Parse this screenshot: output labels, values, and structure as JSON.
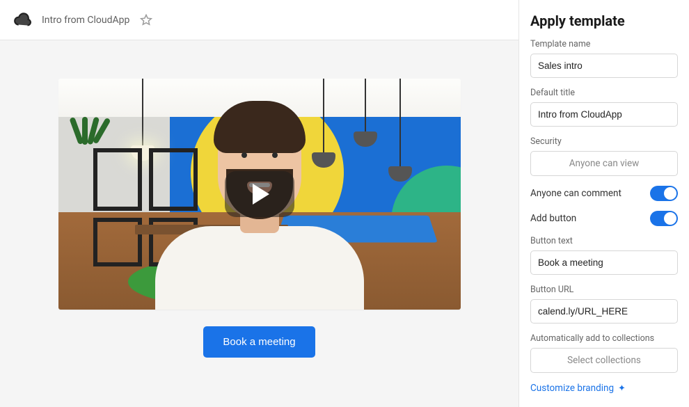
{
  "topbar": {
    "title": "Intro from CloudApp"
  },
  "content": {
    "cta_label": "Book a meeting"
  },
  "sidebar": {
    "heading": "Apply template",
    "template_name": {
      "label": "Template name",
      "value": "Sales intro"
    },
    "default_title": {
      "label": "Default title",
      "value": "Intro from CloudApp"
    },
    "security": {
      "label": "Security",
      "value": "Anyone can view"
    },
    "anyone_comment": {
      "label": "Anyone can comment",
      "on": true
    },
    "add_button": {
      "label": "Add button",
      "on": true
    },
    "button_text": {
      "label": "Button text",
      "value": "Book a meeting"
    },
    "button_url": {
      "label": "Button URL",
      "value": "calend.ly/URL_HERE"
    },
    "collections": {
      "label": "Automatically add to collections",
      "placeholder": "Select collections"
    },
    "branding_link": "Customize branding"
  }
}
